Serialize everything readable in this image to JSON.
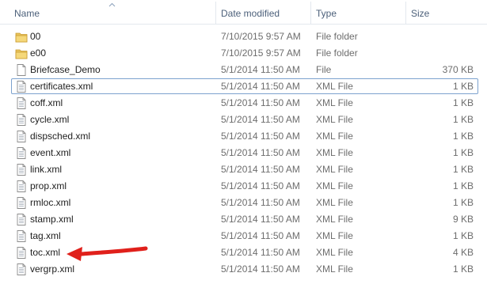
{
  "columns": {
    "name": "Name",
    "date": "Date modified",
    "type": "Type",
    "size": "Size"
  },
  "files": [
    {
      "name": "00",
      "date": "7/10/2015 9:57 AM",
      "type": "File folder",
      "size": "",
      "icon": "folder-icon"
    },
    {
      "name": "e00",
      "date": "7/10/2015 9:57 AM",
      "type": "File folder",
      "size": "",
      "icon": "folder-icon"
    },
    {
      "name": "Briefcase_Demo",
      "date": "5/1/2014 11:50 AM",
      "type": "File",
      "size": "370 KB",
      "icon": "file-icon"
    },
    {
      "name": "certificates.xml",
      "date": "5/1/2014 11:50 AM",
      "type": "XML File",
      "size": "1 KB",
      "icon": "xml-file-icon",
      "selected": true
    },
    {
      "name": "coff.xml",
      "date": "5/1/2014 11:50 AM",
      "type": "XML File",
      "size": "1 KB",
      "icon": "xml-file-icon"
    },
    {
      "name": "cycle.xml",
      "date": "5/1/2014 11:50 AM",
      "type": "XML File",
      "size": "1 KB",
      "icon": "xml-file-icon"
    },
    {
      "name": "dispsched.xml",
      "date": "5/1/2014 11:50 AM",
      "type": "XML File",
      "size": "1 KB",
      "icon": "xml-file-icon"
    },
    {
      "name": "event.xml",
      "date": "5/1/2014 11:50 AM",
      "type": "XML File",
      "size": "1 KB",
      "icon": "xml-file-icon"
    },
    {
      "name": "link.xml",
      "date": "5/1/2014 11:50 AM",
      "type": "XML File",
      "size": "1 KB",
      "icon": "xml-file-icon"
    },
    {
      "name": "prop.xml",
      "date": "5/1/2014 11:50 AM",
      "type": "XML File",
      "size": "1 KB",
      "icon": "xml-file-icon"
    },
    {
      "name": "rmloc.xml",
      "date": "5/1/2014 11:50 AM",
      "type": "XML File",
      "size": "1 KB",
      "icon": "xml-file-icon"
    },
    {
      "name": "stamp.xml",
      "date": "5/1/2014 11:50 AM",
      "type": "XML File",
      "size": "9 KB",
      "icon": "xml-file-icon"
    },
    {
      "name": "tag.xml",
      "date": "5/1/2014 11:50 AM",
      "type": "XML File",
      "size": "1 KB",
      "icon": "xml-file-icon"
    },
    {
      "name": "toc.xml",
      "date": "5/1/2014 11:50 AM",
      "type": "XML File",
      "size": "4 KB",
      "icon": "xml-file-icon",
      "highlighted_by_arrow": true
    },
    {
      "name": "vergrp.xml",
      "date": "5/1/2014 11:50 AM",
      "type": "XML File",
      "size": "1 KB",
      "icon": "xml-file-icon"
    }
  ],
  "colors": {
    "header_text": "#4c607a",
    "selection_border": "#7da2ce",
    "annotation_arrow": "#e0201b",
    "folder": "#e8c35c"
  }
}
